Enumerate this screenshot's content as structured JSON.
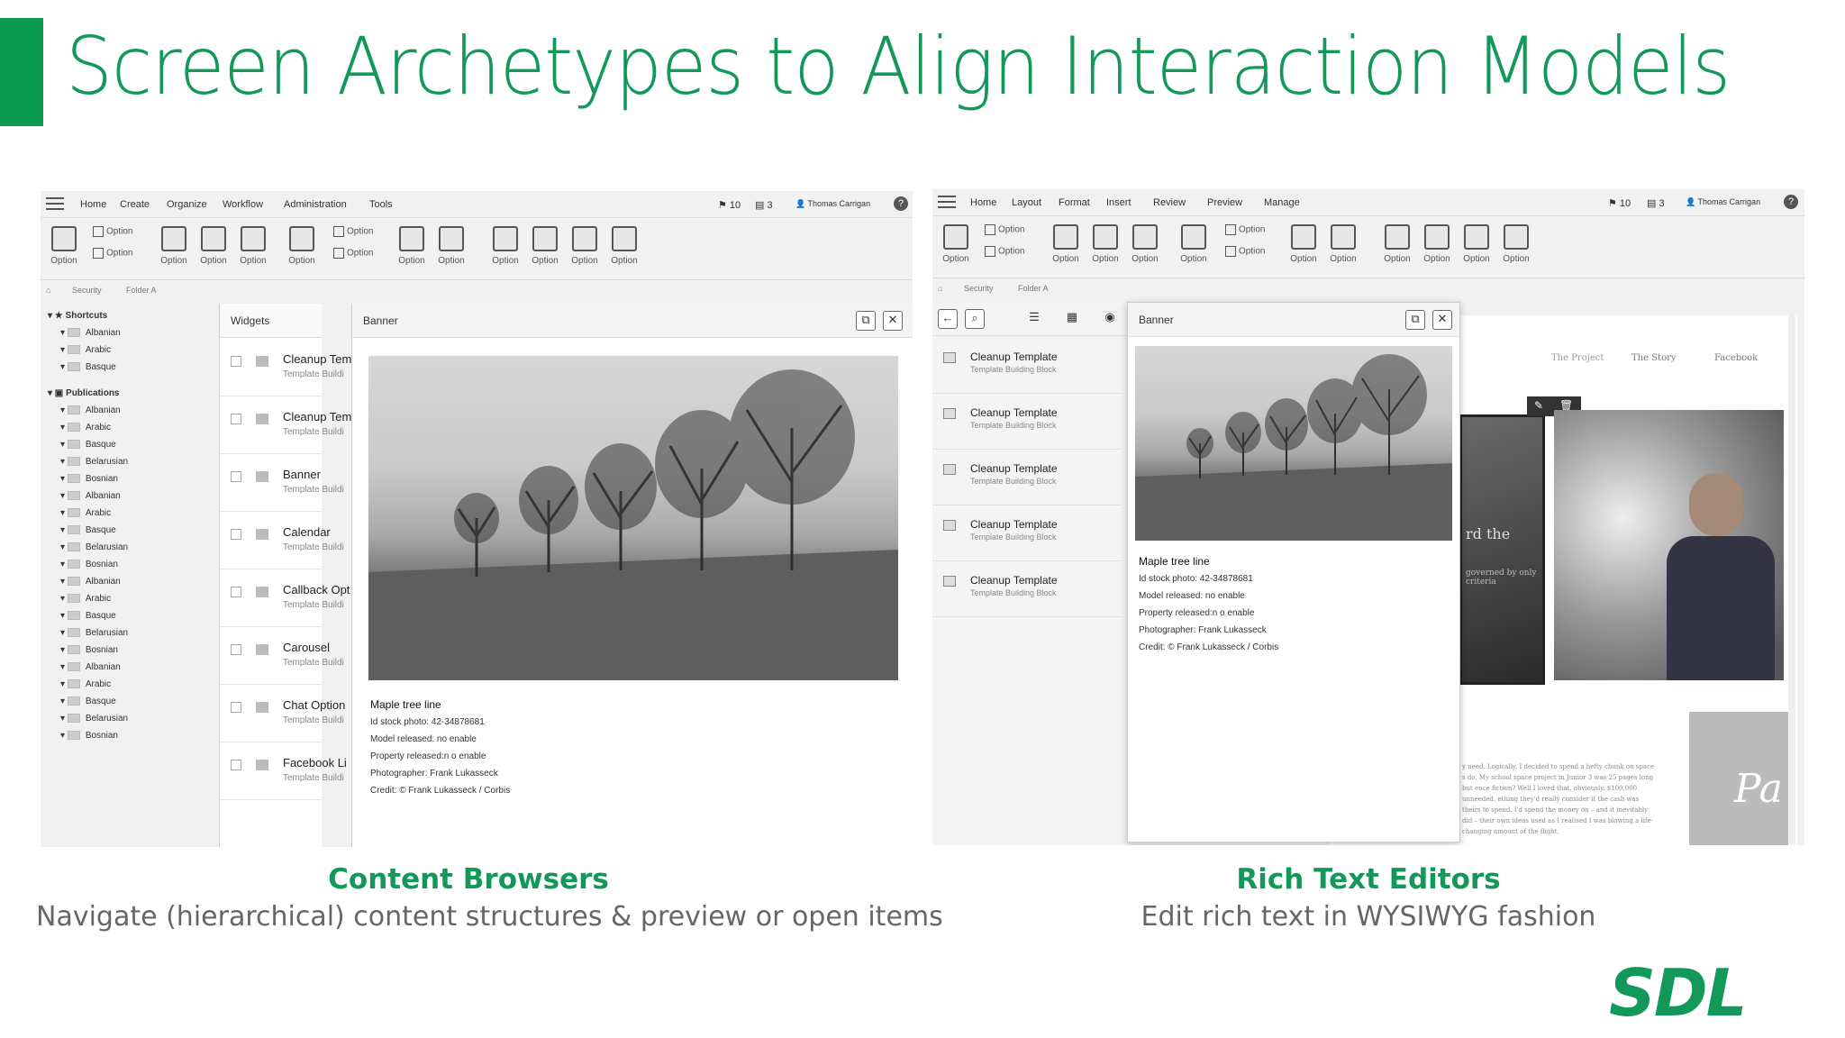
{
  "slide": {
    "title": "Screen Archetypes to Align Interaction Models",
    "accent_color": "#0a9a4f",
    "logo_text": "SDL"
  },
  "left": {
    "caption_title": "Content Browsers",
    "caption_sub": "Navigate (hierarchical) content structures & preview or open items",
    "menu": [
      "Home",
      "Create",
      "Organize",
      "Workflow",
      "Administration",
      "Tools"
    ],
    "flags_count": "10",
    "tasks_count": "3",
    "user": "Thomas Carrigan",
    "ribbon_label": "Option",
    "breadcrumb": [
      "Security",
      "Folder A"
    ],
    "tree": {
      "shortcuts_label": "Shortcuts",
      "shortcuts": [
        "Albanian",
        "Arabic",
        "Basque"
      ],
      "publications_label": "Publications",
      "publications": [
        "Albanian",
        "Arabic",
        "Basque",
        "Belarusian",
        "Bosnian",
        "Albanian",
        "Arabic",
        "Basque",
        "Belarusian",
        "Bosnian",
        "Albanian",
        "Arabic",
        "Basque",
        "Belarusian",
        "Bosnian",
        "Albanian",
        "Arabic",
        "Basque",
        "Belarusian",
        "Bosnian"
      ]
    },
    "widgets_header": "Widgets",
    "widgets": [
      {
        "title": "Cleanup Tem",
        "sub": "Template Buildi"
      },
      {
        "title": "Cleanup Tem",
        "sub": "Template Buildi"
      },
      {
        "title": "Banner",
        "sub": "Template Buildi"
      },
      {
        "title": "Calendar",
        "sub": "Template Buildi"
      },
      {
        "title": "Callback Opt",
        "sub": "Template Buildi"
      },
      {
        "title": "Carousel",
        "sub": "Template Buildi"
      },
      {
        "title": "Chat Option",
        "sub": "Template Buildi"
      },
      {
        "title": "Facebook Li",
        "sub": "Template Buildi"
      }
    ],
    "preview_header": "Banner",
    "preview": {
      "name": "Maple tree line",
      "lines": [
        "Id stock photo: 42-34878681",
        "Model released: no enable",
        "Property released:n o enable",
        "Photographer: Frank Lukasseck",
        "Credit: © Frank Lukasseck / Corbis"
      ]
    }
  },
  "right": {
    "caption_title": "Rich Text Editors",
    "caption_sub": "Edit rich text in WYSIWYG fashion",
    "menu": [
      "Home",
      "Layout",
      "Format",
      "Insert",
      "Review",
      "Preview",
      "Manage"
    ],
    "flags_count": "10",
    "tasks_count": "3",
    "user": "Thomas Carrigan",
    "ribbon_label": "Option",
    "breadcrumb": [
      "Security",
      "Folder A"
    ],
    "list": [
      {
        "title": "Cleanup Template",
        "sub": "Template Building Block"
      },
      {
        "title": "Cleanup Template",
        "sub": "Template Building Block"
      },
      {
        "title": "Cleanup Template",
        "sub": "Template Building Block"
      },
      {
        "title": "Cleanup Template",
        "sub": "Template Building Block"
      },
      {
        "title": "Cleanup Template",
        "sub": "Template Building Block"
      }
    ],
    "preview_header": "Banner",
    "preview": {
      "name": "Maple tree line",
      "lines": [
        "Id stock photo: 42-34878681",
        "Model released: no enable",
        "Property released:n o enable",
        "Photographer: Frank Lukasseck",
        "Credit: © Frank Lukasseck / Corbis"
      ]
    },
    "web_nav": [
      "The Project",
      "The Story",
      "Facebook"
    ],
    "web_fragment": "rd the",
    "web_fragment2": "governed by only criteria",
    "web_body": "y need. Logically, I decided to spend a hefty chunk on space s do. My school space project in Junior 3 was 25 pages long but ence fiction? Well I loved that, obviously. $100,000 unneeded. ething they'd really consider if the cash was theirs to spend. I'd spend the money on – and it inevitably did – their own ideas used as I realised I was blowing a life-changing amount of the flight.",
    "web_big": "Pa"
  }
}
